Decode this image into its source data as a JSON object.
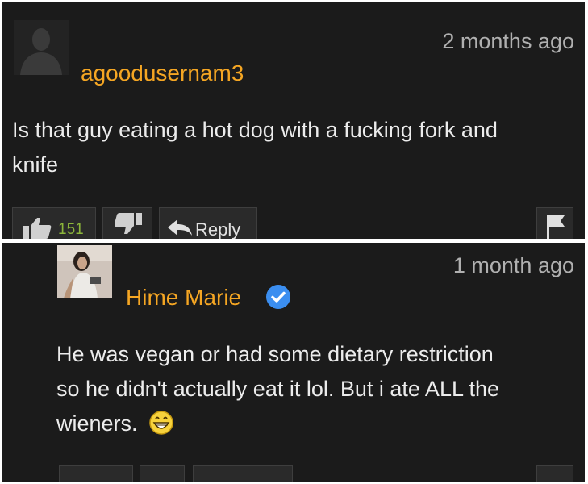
{
  "comments": [
    {
      "timestamp": "2 months ago",
      "username": "agoodusernam3",
      "avatar": "default-user-avatar",
      "text": "Is that guy eating a hot dog with a fucking fork and knife",
      "text_lines": [
        "Is that guy eating a hot dog with a fucking fork and",
        "knife"
      ],
      "upvotes": "151",
      "reply_label": "Reply"
    },
    {
      "timestamp": "1 month ago",
      "username": "Hime Marie",
      "verified": true,
      "avatar": "user-photo-avatar",
      "text": "He was vegan or had some dietary restriction so he didn't actually eat it lol. But i ate ALL the wieners.",
      "text_lines": [
        "He was vegan or had some dietary restriction",
        "so he didn't actually eat it lol. But i ate ALL the",
        "wieners."
      ],
      "emoji": "grinning-emoji"
    }
  ],
  "colors": {
    "background": "#1b1b1b",
    "username": "#f5a623",
    "timestamp": "#b0b0b0",
    "upvote_count": "#8cb53a",
    "verified_badge": "#3b8ef0"
  }
}
